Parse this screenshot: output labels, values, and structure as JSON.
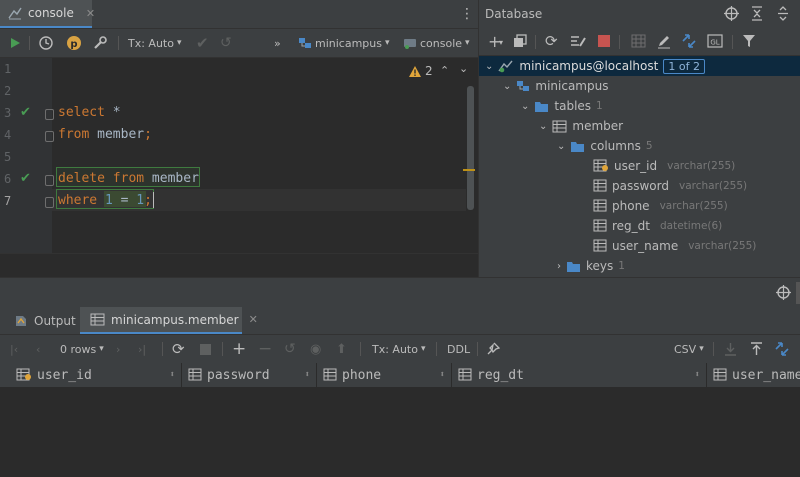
{
  "editor": {
    "tab_label": "console",
    "toolbar": {
      "tx_label": "Tx: Auto",
      "datasource": "minicampus",
      "session": "console"
    },
    "inspection_count": "2",
    "lines": [
      {
        "no": "1",
        "check": false,
        "tokens": []
      },
      {
        "no": "2",
        "check": false,
        "tokens": []
      },
      {
        "no": "3",
        "check": true,
        "tokens": [
          {
            "t": "select",
            "c": "kw"
          },
          {
            "t": " *",
            "c": "id"
          }
        ]
      },
      {
        "no": "4",
        "check": false,
        "tokens": [
          {
            "t": "from",
            "c": "kw"
          },
          {
            "t": " member",
            "c": "id"
          },
          {
            "t": ";",
            "c": "kw"
          }
        ]
      },
      {
        "no": "5",
        "check": false,
        "tokens": []
      },
      {
        "no": "6",
        "check": true,
        "tokens": [
          {
            "t": "delete",
            "c": "kw"
          },
          {
            "t": " ",
            "c": "id"
          },
          {
            "t": "from",
            "c": "kw"
          },
          {
            "t": " member",
            "c": "id"
          }
        ]
      },
      {
        "no": "7",
        "check": false,
        "tokens": [
          {
            "t": "where",
            "c": "kw"
          },
          {
            "t": " ",
            "c": "id"
          },
          {
            "t": "1",
            "c": "num"
          },
          {
            "t": " = ",
            "c": "id"
          },
          {
            "t": "1",
            "c": "num"
          },
          {
            "t": ";",
            "c": "kw"
          }
        ]
      }
    ]
  },
  "database": {
    "title": "Database",
    "connection": "minicampus@localhost",
    "connection_badge": "1 of 2",
    "schema": "minicampus",
    "tables_label": "tables",
    "tables_count": "1",
    "table_name": "member",
    "columns_label": "columns",
    "columns_count": "5",
    "columns": [
      {
        "name": "user_id",
        "type": "varchar(255)"
      },
      {
        "name": "password",
        "type": "varchar(255)"
      },
      {
        "name": "phone",
        "type": "varchar(255)"
      },
      {
        "name": "reg_dt",
        "type": "datetime(6)"
      },
      {
        "name": "user_name",
        "type": "varchar(255)"
      }
    ],
    "keys_label": "keys",
    "keys_count": "1"
  },
  "results": {
    "output_tab": "Output",
    "table_tab": "minicampus.member",
    "rows_label": "0 rows",
    "tx_label": "Tx: Auto",
    "ddl_label": "DDL",
    "export_label": "CSV",
    "headers": [
      "user_id",
      "password",
      "phone",
      "reg_dt",
      "user_name"
    ]
  },
  "colors": {
    "keyword": "#cc7832",
    "number": "#6897bb",
    "accent": "#4a88c7",
    "run_green": "#499c54"
  }
}
